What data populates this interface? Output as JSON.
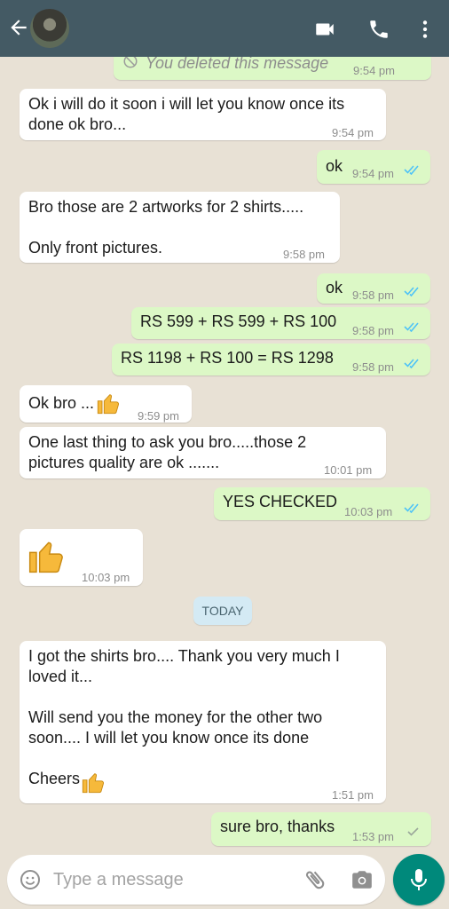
{
  "header": {
    "back_icon": "arrow-left-icon",
    "avatar": "contact-avatar",
    "icons": [
      "video-call-icon",
      "voice-call-icon",
      "more-vert-icon"
    ],
    "colors": {
      "bar": "#445a64",
      "icon": "#ffffff"
    }
  },
  "chat": {
    "messages": [
      {
        "dir": "out",
        "text": "You deleted this message",
        "time": "9:54 pm",
        "deleted": true
      },
      {
        "dir": "in",
        "text": "Ok i will do it soon i will let you know once its\ndone ok bro...",
        "time": "9:54 pm"
      },
      {
        "dir": "out",
        "text": "ok",
        "time": "9:54 pm",
        "status": "read"
      },
      {
        "dir": "in",
        "text": "Bro those are 2 artworks for 2 shirts.....\n\nOnly front pictures.",
        "time": "9:58 pm"
      },
      {
        "dir": "out",
        "text": "ok",
        "time": "9:58 pm",
        "status": "read"
      },
      {
        "dir": "out",
        "text": "RS 599 + RS 599 + RS 100",
        "time": "9:58 pm",
        "status": "read"
      },
      {
        "dir": "out",
        "text": "RS 1198 + RS 100 = RS 1298",
        "time": "9:58 pm",
        "status": "read"
      },
      {
        "dir": "in",
        "text": "Ok bro ...",
        "emoji": "thumbs-up",
        "time": "9:59 pm"
      },
      {
        "dir": "in",
        "text": "One last thing to ask you bro.....those 2\npictures quality are ok .......",
        "time": "10:01 pm"
      },
      {
        "dir": "out",
        "text": "YES CHECKED",
        "time": "10:03 pm",
        "status": "read"
      },
      {
        "dir": "in",
        "text": "",
        "emoji": "thumbs-up-large",
        "time": "10:03 pm"
      },
      {
        "dir": "in",
        "text": "I got the shirts bro.... Thank you very much I\nloved it...\n\nWill send you the money for the other two\nsoon.... I will let you know once its done\n\nCheers",
        "emoji": "thumbs-up",
        "time": "1:51 pm"
      },
      {
        "dir": "out",
        "text": "sure bro, thanks",
        "time": "1:53 pm",
        "status": "sent"
      }
    ],
    "date_chip": "TODAY",
    "colors": {
      "background": "#e8e1d5",
      "incoming": "#ffffff",
      "outgoing": "#dcf8c6",
      "read_ticks": "#4fc3f7",
      "sent_tick": "#9aa79a"
    }
  },
  "composer": {
    "placeholder": "Type a message",
    "value": "",
    "icons": [
      "emoji-icon",
      "attach-icon",
      "camera-icon",
      "mic-icon"
    ],
    "colors": {
      "send_button": "#00897b"
    }
  }
}
